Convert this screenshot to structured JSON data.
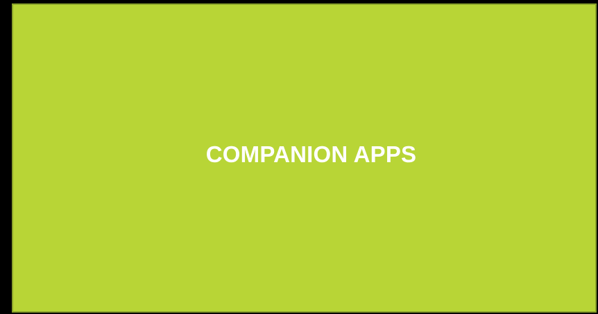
{
  "panel": {
    "title": "COMPANION APPS",
    "background_color": "#b8d536",
    "border_color": "#8aa32a",
    "text_color": "#ffffff"
  },
  "page": {
    "background_color": "#000000"
  }
}
